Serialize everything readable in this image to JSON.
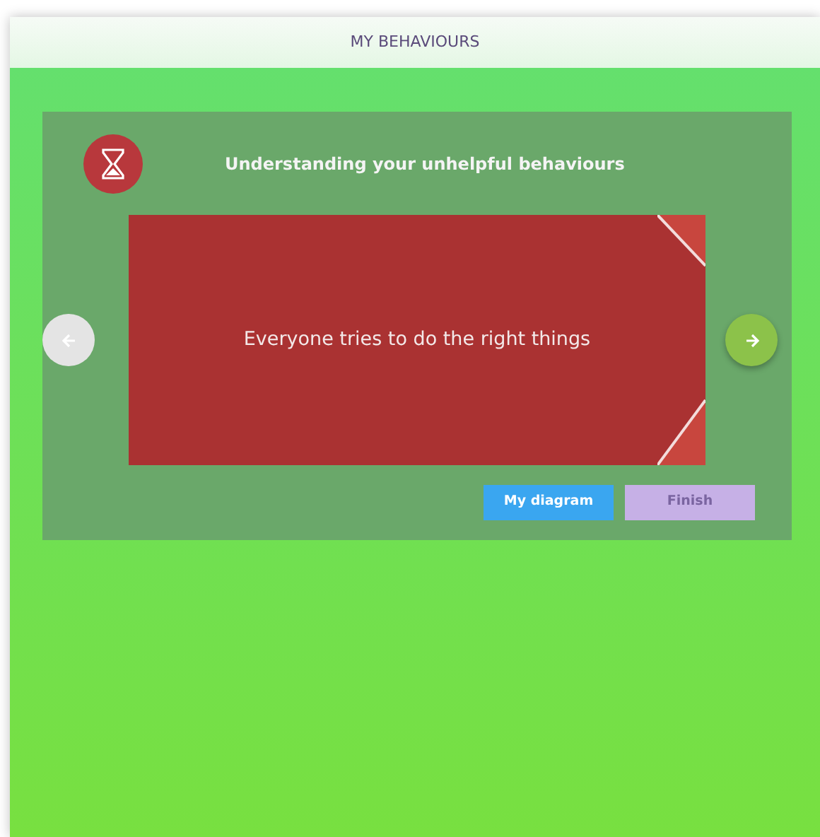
{
  "header": {
    "title": "MY BEHAVIOURS"
  },
  "activity": {
    "title": "Understanding your unhelpful behaviours",
    "card": {
      "text": "Everyone tries to do the right things"
    },
    "previous": {
      "disabled": true
    },
    "next": {
      "disabled": false
    },
    "buttons": [
      {
        "label": "My diagram",
        "kind": "primary",
        "disabled": false
      },
      {
        "label": "Finish",
        "kind": "secondary",
        "disabled": true
      }
    ]
  }
}
